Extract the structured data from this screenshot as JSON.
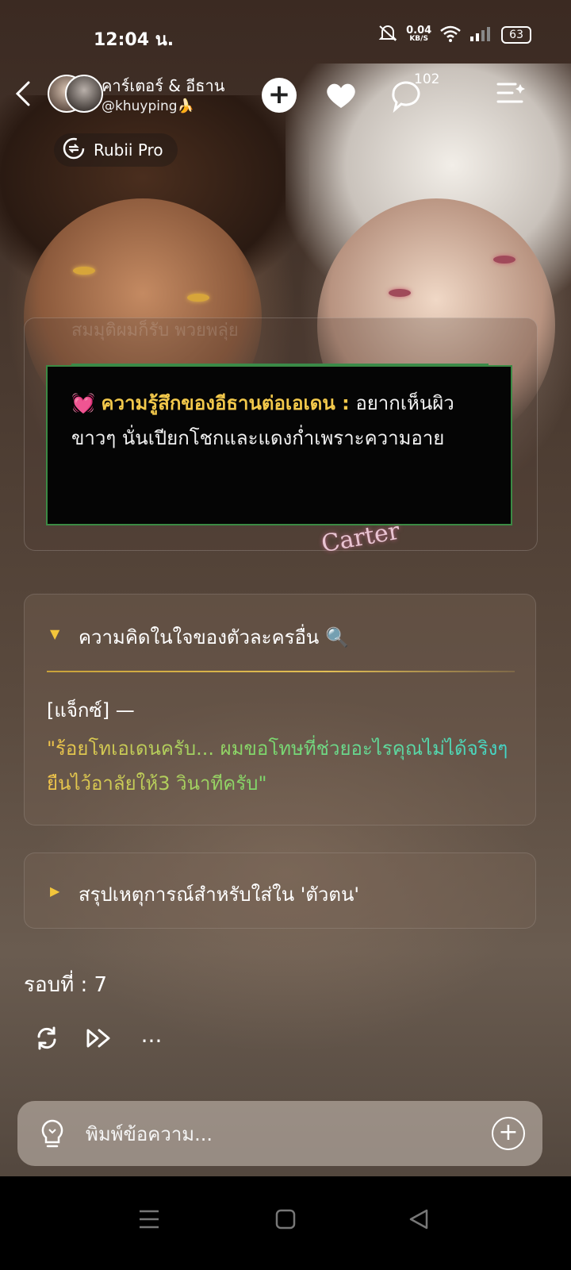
{
  "status_bar": {
    "time": "12:04 น.",
    "net_speed": "0.04",
    "net_unit": "KB/S",
    "battery": "63"
  },
  "header": {
    "character_name": "คาร์เตอร์ & อีธาน",
    "handle": "@khuyping🍌",
    "comment_count": "102",
    "badge_label": "Rubii Pro"
  },
  "chat": {
    "faded_text": "สมมุติผมก็รับ พวยพลุ่ย",
    "feeling_emoji": "💓",
    "feeling_label": "ความรู้สึกของอีธานต่อเอเดน :",
    "feeling_text": "อยากเห็นผิวขาวๆ นั่นเปียกโชกและแดงก่ำเพราะความอาย",
    "watermark": "Carter",
    "thoughts": {
      "toggle": "▼",
      "title": "ความคิดในใจของตัวละครอื่น 🔍",
      "speaker": "[แจ็กซ์] —",
      "quote": "\"ร้อยโทเอเดนครับ... ผมขอโทษที่ช่วยอะไรคุณไม่ได้จริงๆ ยืนไว้อาลัยให้3 วินาทีครับ\""
    },
    "summary": {
      "toggle": "▶",
      "title": "สรุปเหตุการณ์สำหรับใส่ใน 'ตัวตน'"
    },
    "round_label": "รอบที่ : 7",
    "more_label": "···"
  },
  "input": {
    "placeholder": "พิมพ์ข้อความ..."
  },
  "theme": {
    "accent_gold": "#f2c84b",
    "border_green": "#3b8a44"
  }
}
